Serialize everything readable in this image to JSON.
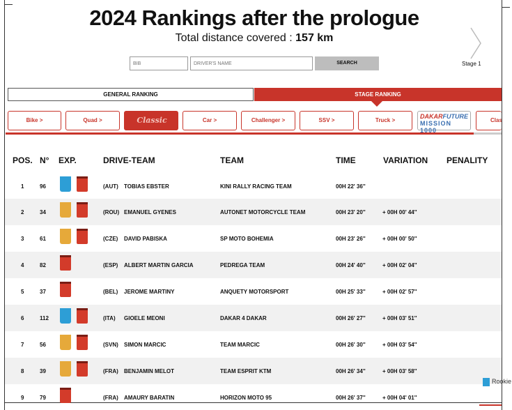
{
  "header": {
    "title": "2024 Rankings after the prologue",
    "subtitle_prefix": "Total distance covered : ",
    "subtitle_value": "157 km",
    "stage_label": "Stage 1"
  },
  "search": {
    "bib_placeholder": "BIB",
    "driver_placeholder": "DRIVER'S NAME",
    "button_label": "SEARCH"
  },
  "ranking_tabs": {
    "general": "GENERAL RANKING",
    "stage": "STAGE RANKING"
  },
  "categories": {
    "bike": "Bike >",
    "quad": "Quad >",
    "active_logo": "Classic",
    "car": "Car >",
    "challenger": "Challenger >",
    "ssv": "SSV >",
    "truck": "Truck >",
    "dakar_future_1": "DAKAR",
    "dakar_future_2": "FUTURE",
    "dakar_future_3": "MISSION 1000",
    "clas": "Clas"
  },
  "colors": {
    "accent": "#c8342a",
    "rookie": "#2d9ed6",
    "experienced": "#e6a93a"
  },
  "table": {
    "headers": {
      "pos": "POS.",
      "num": "N°",
      "exp": "EXP.",
      "drive_team": "DRIVE-TEAM",
      "team": "TEAM",
      "time": "TIME",
      "variation": "VARIATION",
      "penality": "PENALITY"
    },
    "rows": [
      {
        "pos": "1",
        "num": "96",
        "nat": "(AUT)",
        "driver": "TOBIAS EBSTER",
        "team": "KINI RALLY RACING TEAM",
        "time": "00H 22' 36''",
        "variation": "",
        "jerseys": [
          "blue",
          "red"
        ]
      },
      {
        "pos": "2",
        "num": "34",
        "nat": "(ROU)",
        "driver": "EMANUEL GYENES",
        "team": "AUTONET MOTORCYCLE TEAM",
        "time": "00H 23' 20''",
        "variation": "+ 00H 00' 44''",
        "jerseys": [
          "yellow",
          "red"
        ]
      },
      {
        "pos": "3",
        "num": "61",
        "nat": "(CZE)",
        "driver": "DAVID PABISKA",
        "team": "SP MOTO BOHEMIA",
        "time": "00H 23' 26''",
        "variation": "+ 00H 00' 50''",
        "jerseys": [
          "yellow",
          "red"
        ]
      },
      {
        "pos": "4",
        "num": "82",
        "nat": "(ESP)",
        "driver": "ALBERT MARTIN GARCIA",
        "team": "PEDREGA TEAM",
        "time": "00H 24' 40''",
        "variation": "+ 00H 02' 04''",
        "jerseys": [
          "red"
        ]
      },
      {
        "pos": "5",
        "num": "37",
        "nat": "(BEL)",
        "driver": "JEROME MARTINY",
        "team": "ANQUETY MOTORSPORT",
        "time": "00H 25' 33''",
        "variation": "+ 00H 02' 57''",
        "jerseys": [
          "red"
        ]
      },
      {
        "pos": "6",
        "num": "112",
        "nat": "(ITA)",
        "driver": "GIOELE MEONI",
        "team": "DAKAR 4 DAKAR",
        "time": "00H 26' 27''",
        "variation": "+ 00H 03' 51''",
        "jerseys": [
          "blue",
          "red"
        ]
      },
      {
        "pos": "7",
        "num": "56",
        "nat": "(SVN)",
        "driver": "SIMON MARCIC",
        "team": "TEAM MARCIC",
        "time": "00H 26' 30''",
        "variation": "+ 00H 03' 54''",
        "jerseys": [
          "yellow",
          "red"
        ]
      },
      {
        "pos": "8",
        "num": "39",
        "nat": "(FRA)",
        "driver": "BENJAMIN MELOT",
        "team": "TEAM ESPRIT KTM",
        "time": "00H 26' 34''",
        "variation": "+ 00H 03' 58''",
        "jerseys": [
          "yellow",
          "red"
        ]
      },
      {
        "pos": "9",
        "num": "79",
        "nat": "(FRA)",
        "driver": "AMAURY BARATIN",
        "team": "HORIZON MOTO 95",
        "time": "00H 26' 37''",
        "variation": "+ 00H 04' 01''",
        "jerseys": [
          "red"
        ]
      }
    ]
  },
  "legend": {
    "rookie": "Rookie"
  }
}
